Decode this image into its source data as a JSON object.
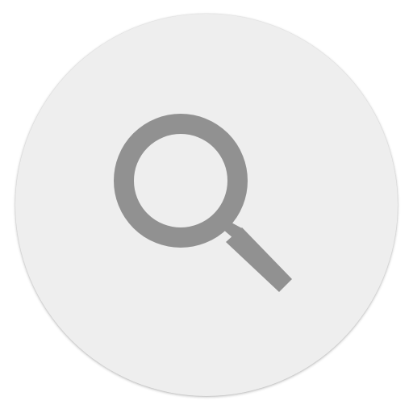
{
  "search_button": {
    "icon": "search-icon",
    "background_color": "#eeeeee",
    "icon_color": "#919191"
  }
}
